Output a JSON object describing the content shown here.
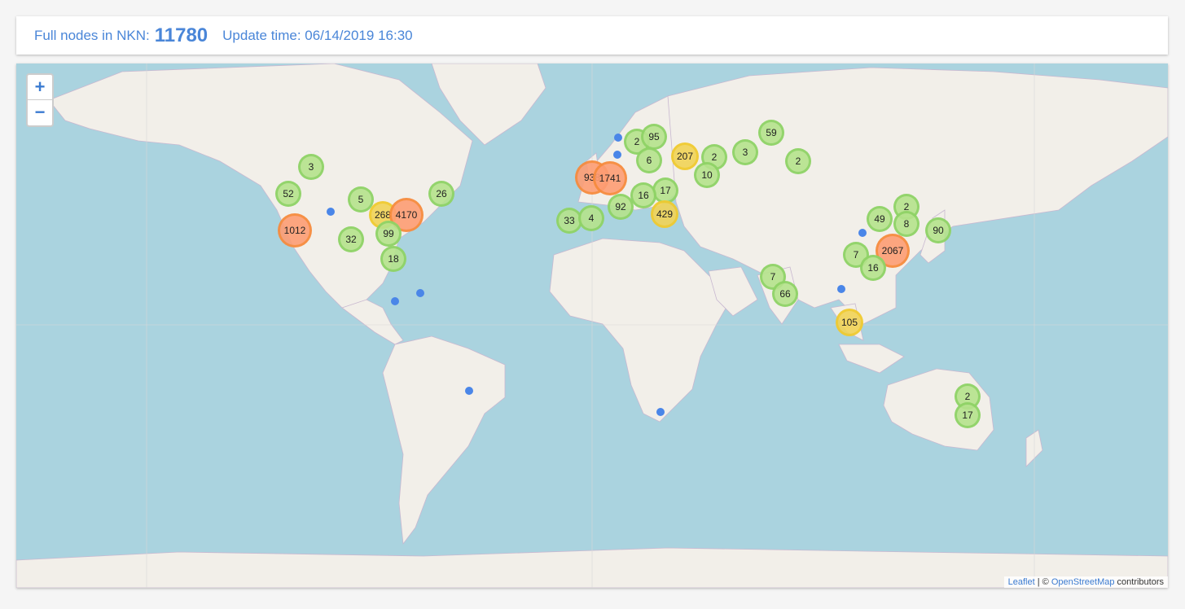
{
  "header": {
    "label": "Full nodes in NKN:",
    "count": "11780",
    "update": "Update time: 06/14/2019 16:30"
  },
  "zoom": {
    "in": "+",
    "out": "−"
  },
  "attribution": {
    "leaflet": "Leaflet",
    "separator": " | © ",
    "osm": "OpenStreetMap",
    "suffix": " contributors"
  },
  "colors": {
    "water": "#aad3df",
    "land": "#f2efe9",
    "accent": "#4a86d8"
  },
  "clusters": [
    {
      "label": "3",
      "level": "green"
    },
    {
      "label": "52",
      "level": "green"
    },
    {
      "label": "1012",
      "level": "orange"
    },
    {
      "label": "5",
      "level": "green"
    },
    {
      "label": "268",
      "level": "yellow"
    },
    {
      "label": "4170",
      "level": "orange"
    },
    {
      "label": "26",
      "level": "green"
    },
    {
      "label": "32",
      "level": "green"
    },
    {
      "label": "99",
      "level": "green"
    },
    {
      "label": "18",
      "level": "green"
    },
    {
      "label": "2",
      "level": "green"
    },
    {
      "label": "95",
      "level": "green"
    },
    {
      "label": "6",
      "level": "green"
    },
    {
      "label": "207",
      "level": "yellow"
    },
    {
      "label": "2",
      "level": "green"
    },
    {
      "label": "10",
      "level": "green"
    },
    {
      "label": "3",
      "level": "green"
    },
    {
      "label": "59",
      "level": "green"
    },
    {
      "label": "2",
      "level": "green"
    },
    {
      "label": "938",
      "level": "orange"
    },
    {
      "label": "1741",
      "level": "orange"
    },
    {
      "label": "17",
      "level": "green"
    },
    {
      "label": "16",
      "level": "green"
    },
    {
      "label": "92",
      "level": "green"
    },
    {
      "label": "429",
      "level": "yellow"
    },
    {
      "label": "33",
      "level": "green"
    },
    {
      "label": "4",
      "level": "green"
    },
    {
      "label": "2",
      "level": "green"
    },
    {
      "label": "49",
      "level": "green"
    },
    {
      "label": "8",
      "level": "green"
    },
    {
      "label": "90",
      "level": "green"
    },
    {
      "label": "2067",
      "level": "orange"
    },
    {
      "label": "7",
      "level": "green"
    },
    {
      "label": "16",
      "level": "green"
    },
    {
      "label": "7",
      "level": "green"
    },
    {
      "label": "66",
      "level": "green"
    },
    {
      "label": "105",
      "level": "yellow"
    },
    {
      "label": "2",
      "level": "green"
    },
    {
      "label": "17",
      "level": "green"
    }
  ],
  "single_markers_count": 9
}
